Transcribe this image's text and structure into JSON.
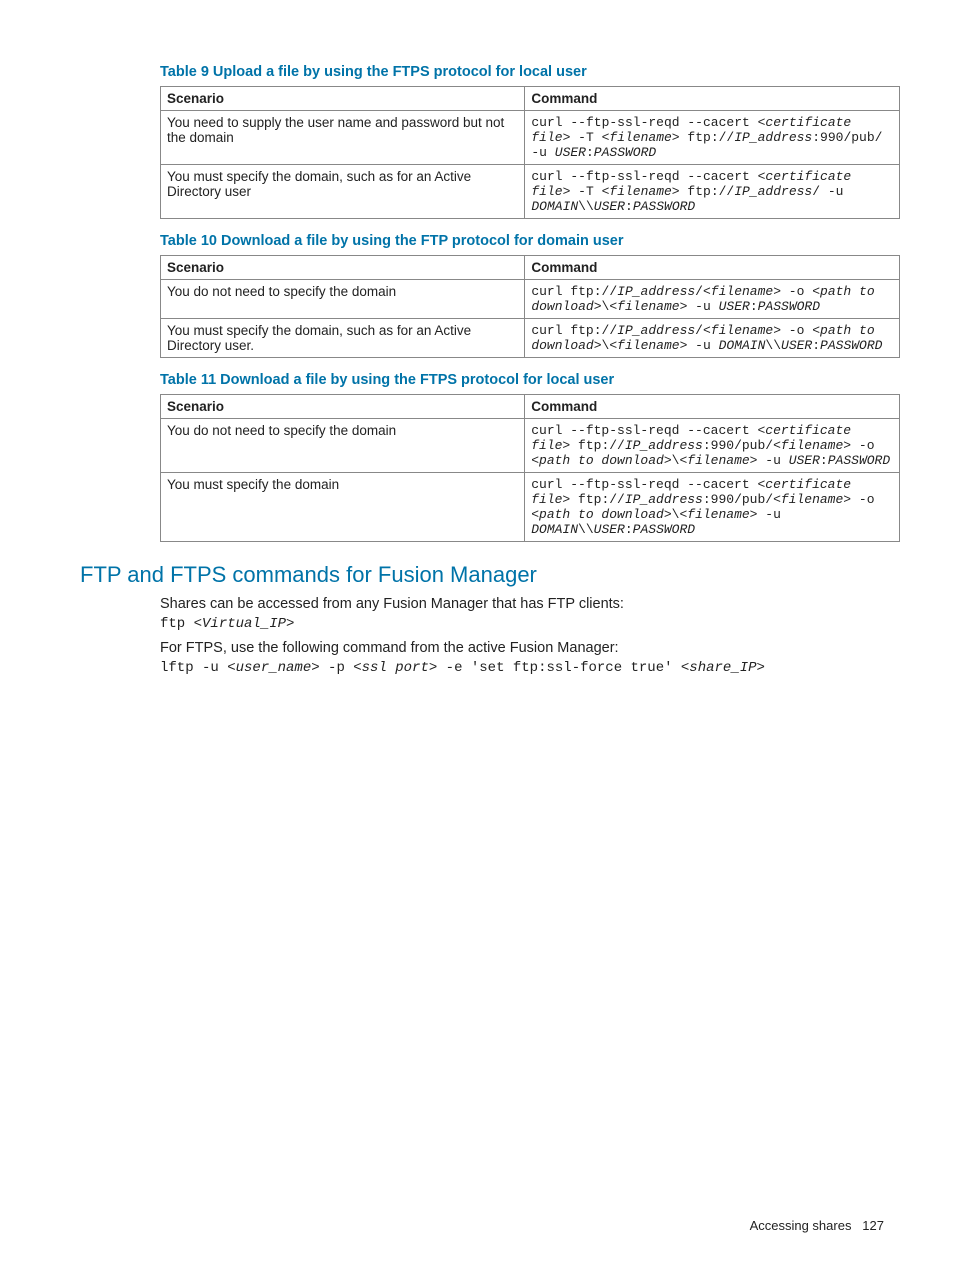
{
  "tables": [
    {
      "title": "Table 9 Upload a file by using the FTPS protocol for local user",
      "head": [
        "Scenario",
        "Command"
      ],
      "rows": [
        {
          "scenario": "You need to supply the user name and password but not the domain",
          "cmd": [
            {
              "t": "curl --ftp-ssl-reqd --cacert "
            },
            {
              "t": "<certificate file>",
              "i": true
            },
            {
              "t": " -T "
            },
            {
              "t": "<filename>",
              "i": true
            },
            {
              "t": " ftp://"
            },
            {
              "t": "IP_address",
              "i": true
            },
            {
              "t": ":990/pub/ -u "
            },
            {
              "t": "USER",
              "i": true
            },
            {
              "t": ":"
            },
            {
              "t": "PASSWORD",
              "i": true
            }
          ]
        },
        {
          "scenario": "You must specify the domain, such as for an Active Directory user",
          "cmd": [
            {
              "t": "curl --ftp-ssl-reqd --cacert "
            },
            {
              "t": "<certificate file>",
              "i": true
            },
            {
              "t": " -T "
            },
            {
              "t": "<filename>",
              "i": true
            },
            {
              "t": " ftp://"
            },
            {
              "t": "IP_address",
              "i": true
            },
            {
              "t": "/ -u "
            },
            {
              "t": "DOMAIN",
              "i": true
            },
            {
              "t": "\\\\"
            },
            {
              "t": "USER",
              "i": true
            },
            {
              "t": ":"
            },
            {
              "t": "PASSWORD",
              "i": true
            }
          ]
        }
      ]
    },
    {
      "title": "Table 10 Download a file by using the FTP protocol for domain user",
      "head": [
        "Scenario",
        "Command"
      ],
      "rows": [
        {
          "scenario": "You do not need to specify the domain",
          "cmd": [
            {
              "t": "curl ftp://"
            },
            {
              "t": "IP_address",
              "i": true
            },
            {
              "t": "/"
            },
            {
              "t": "<filename>",
              "i": true
            },
            {
              "t": " -o "
            },
            {
              "t": "<path to download>",
              "i": true
            },
            {
              "t": "\\"
            },
            {
              "t": "<filename>",
              "i": true
            },
            {
              "t": " -u "
            },
            {
              "t": "USER",
              "i": true
            },
            {
              "t": ":"
            },
            {
              "t": "PASSWORD",
              "i": true
            }
          ]
        },
        {
          "scenario": "You must specify the domain, such as for an Active Directory user.",
          "cmd": [
            {
              "t": "curl ftp://"
            },
            {
              "t": "IP_address",
              "i": true
            },
            {
              "t": "/"
            },
            {
              "t": "<filename>",
              "i": true
            },
            {
              "t": " -o "
            },
            {
              "t": "<path to download>",
              "i": true
            },
            {
              "t": "\\"
            },
            {
              "t": "<filename>",
              "i": true
            },
            {
              "t": " -u "
            },
            {
              "t": "DOMAIN",
              "i": true
            },
            {
              "t": "\\\\"
            },
            {
              "t": "USER",
              "i": true
            },
            {
              "t": ":"
            },
            {
              "t": "PASSWORD",
              "i": true
            }
          ]
        }
      ]
    },
    {
      "title": "Table 11 Download a file by using the FTPS protocol for local user",
      "head": [
        "Scenario",
        "Command"
      ],
      "rows": [
        {
          "scenario": "You do not need to specify the domain",
          "cmd": [
            {
              "t": "curl --ftp-ssl-reqd --cacert "
            },
            {
              "t": "<certificate file>",
              "i": true
            },
            {
              "t": " ftp://"
            },
            {
              "t": "IP_address",
              "i": true
            },
            {
              "t": ":990/pub/"
            },
            {
              "t": "<filename>",
              "i": true
            },
            {
              "t": " -o "
            },
            {
              "t": "<path to download>",
              "i": true
            },
            {
              "t": "\\"
            },
            {
              "t": "<filename>",
              "i": true
            },
            {
              "t": " -u "
            },
            {
              "t": "USER",
              "i": true
            },
            {
              "t": ":"
            },
            {
              "t": "PASSWORD",
              "i": true
            }
          ]
        },
        {
          "scenario": "You must specify the domain",
          "cmd": [
            {
              "t": "curl --ftp-ssl-reqd --cacert "
            },
            {
              "t": "<certificate file>",
              "i": true
            },
            {
              "t": " ftp://"
            },
            {
              "t": "IP_address",
              "i": true
            },
            {
              "t": ":990/pub/"
            },
            {
              "t": "<filename>",
              "i": true
            },
            {
              "t": " -o "
            },
            {
              "t": "<path to download>",
              "i": true
            },
            {
              "t": "\\"
            },
            {
              "t": "<filename>",
              "i": true
            },
            {
              "t": " -u "
            },
            {
              "t": "DOMAIN",
              "i": true
            },
            {
              "t": "\\\\"
            },
            {
              "t": "USER",
              "i": true
            },
            {
              "t": ":"
            },
            {
              "t": "PASSWORD",
              "i": true
            }
          ]
        }
      ]
    }
  ],
  "section": {
    "heading": "FTP and FTPS commands for Fusion Manager",
    "p1": "Shares can be accessed from any Fusion Manager that has FTP clients:",
    "code1": [
      {
        "t": "ftp "
      },
      {
        "t": "<Virtual_IP>",
        "i": true
      }
    ],
    "p2": "For FTPS, use the following command from the active Fusion Manager:",
    "code2": [
      {
        "t": "lftp -u "
      },
      {
        "t": "<user_name>",
        "i": true
      },
      {
        "t": " -p "
      },
      {
        "t": "<ssl port>",
        "i": true
      },
      {
        "t": " -e 'set ftp:ssl-force true' "
      },
      {
        "t": "<share_IP>",
        "i": true
      }
    ]
  },
  "footer": {
    "text": "Accessing shares",
    "page": "127"
  }
}
